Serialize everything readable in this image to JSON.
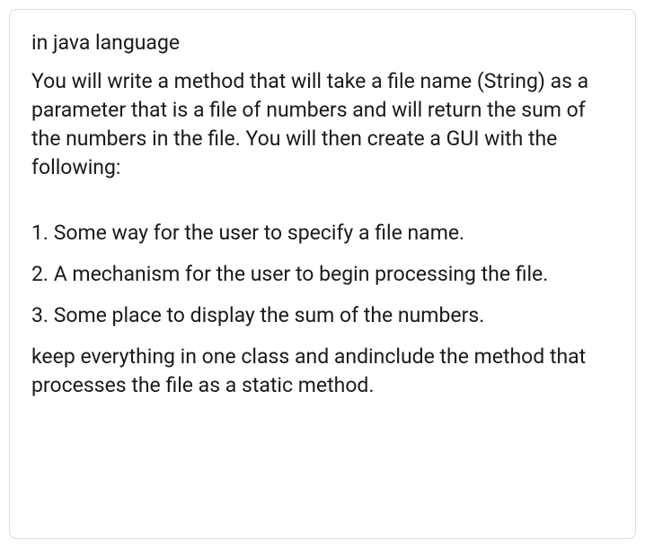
{
  "heading": "in java language",
  "intro": "You will write a method that will take a file name (String) as a parameter that is a file of numbers and will return the sum of the numbers in the file. You will then create a GUI with the following:",
  "items": [
    "1. Some way for the user to specify a file name.",
    "2. A mechanism for the user to begin processing the file.",
    "3. Some place to display the sum of the numbers."
  ],
  "closing": "keep everything in one class and andinclude the method that processes the file as a static method."
}
